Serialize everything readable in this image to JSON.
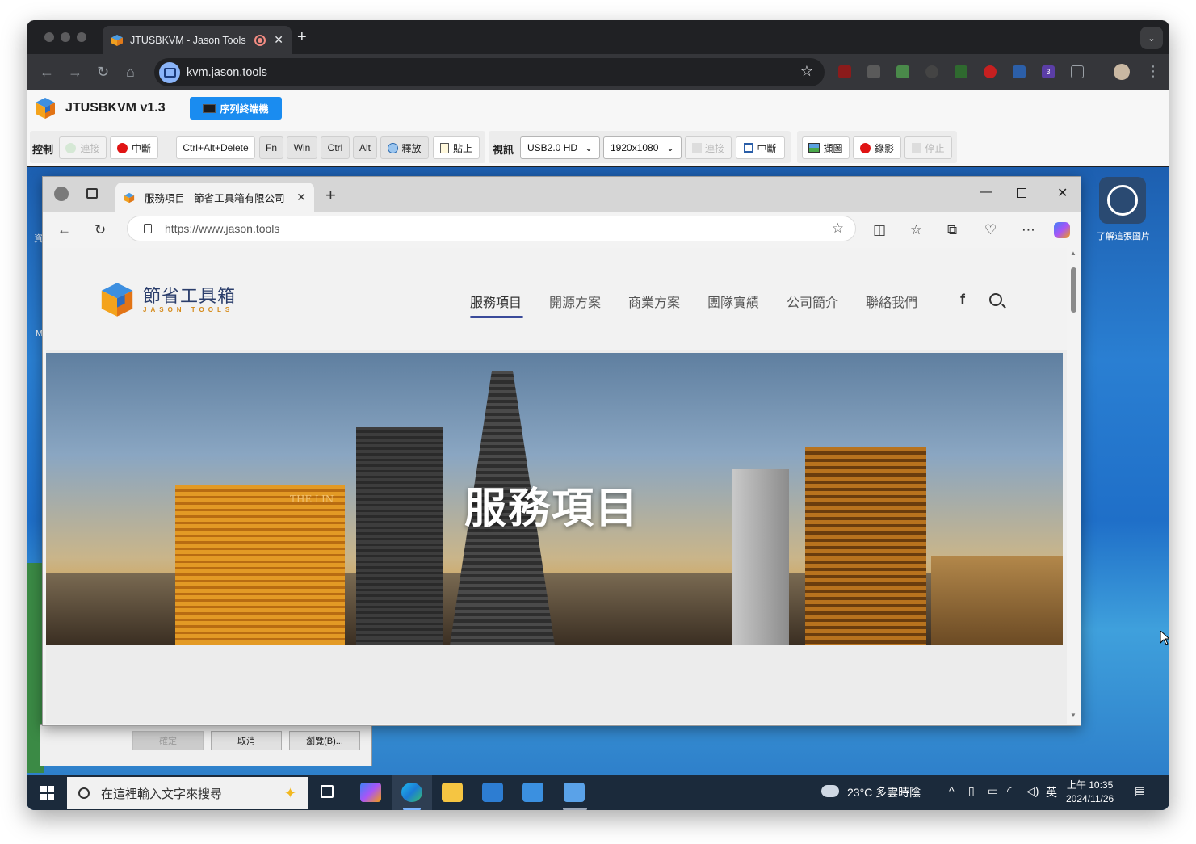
{
  "browser": {
    "tab_title": "JTUSBKVM - Jason Tools",
    "url": "kvm.jason.tools",
    "badges": [
      "3"
    ]
  },
  "app": {
    "title": "JTUSBKVM v1.3",
    "serial_button": "序列終端機",
    "control_label": "控制",
    "connect": "連接",
    "disconnect": "中斷",
    "keys": [
      "Ctrl+Alt+Delete",
      "Fn",
      "Win",
      "Ctrl",
      "Alt"
    ],
    "release": "釋放",
    "paste": "貼上",
    "video_label": "視訊",
    "video_device": "USB2.0 HD",
    "resolution": "1920x1080",
    "video_connect": "連接",
    "video_disconnect": "中斷",
    "screenshot": "擷圖",
    "record": "錄影",
    "stop": "停止"
  },
  "remote": {
    "desktop_icon_label": "了解這張圖片",
    "left_edge_labels": [
      "資",
      "M"
    ],
    "dialog_buttons": [
      "確定",
      "取消",
      "瀏覽(B)..."
    ]
  },
  "edge": {
    "tab_title": "服務項目 - 節省工具箱有限公司",
    "url": "https://www.jason.tools"
  },
  "website": {
    "brand_name": "節省工具箱",
    "brand_sub": "JASON TOOLS",
    "nav": [
      "服務項目",
      "開源方案",
      "商業方案",
      "團隊實績",
      "公司簡介",
      "聯絡我們"
    ],
    "facebook_glyph": "f",
    "hero_title": "服務項目",
    "building_sign": "THE LIN"
  },
  "taskbar": {
    "search_placeholder": "在這裡輸入文字來搜尋",
    "weather": "23°C  多雲時陰",
    "ime": "英",
    "time": "上午 10:35",
    "date": "2024/11/26"
  }
}
